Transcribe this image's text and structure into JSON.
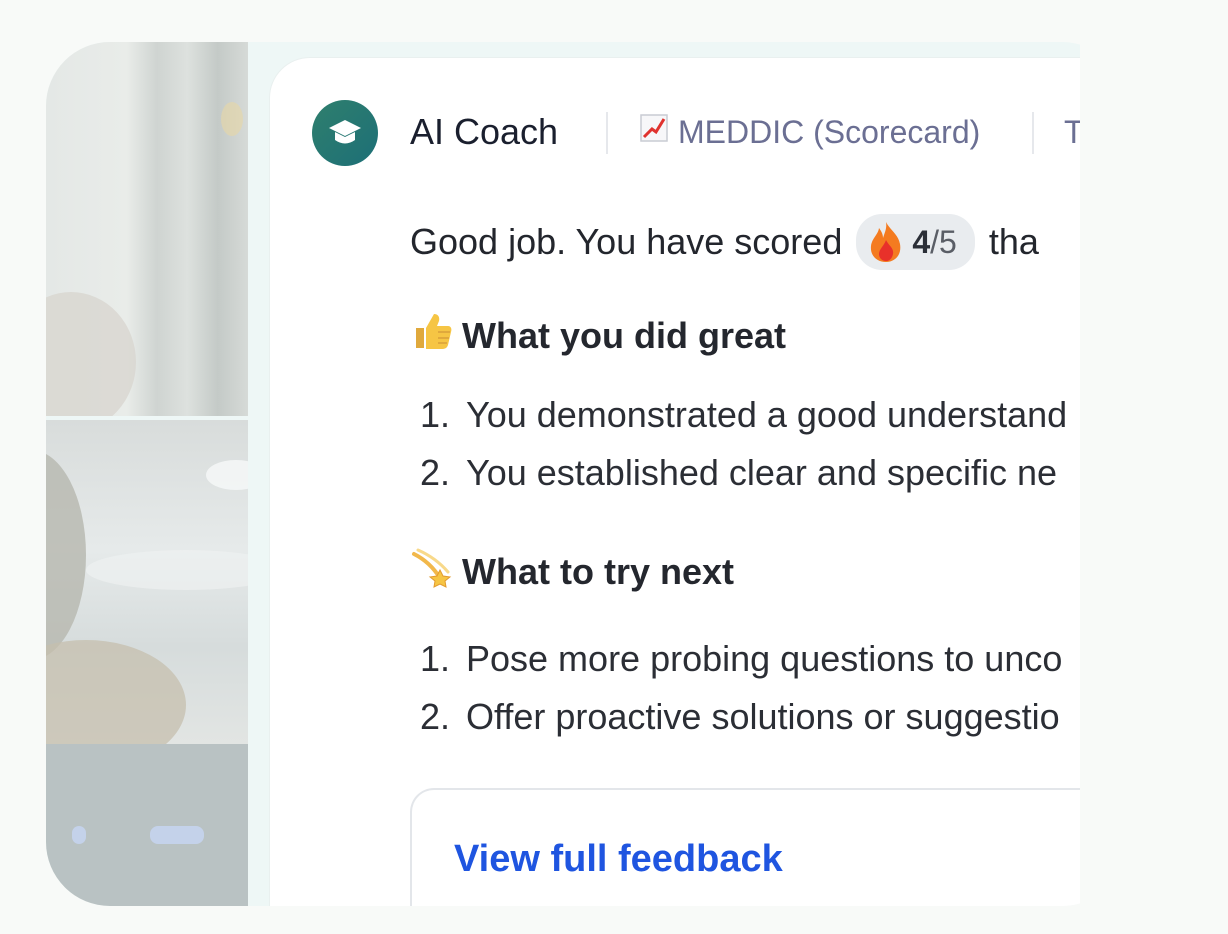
{
  "coach": {
    "name": "AI Coach",
    "scorecard_label": "MEDDIC (Scorecard)",
    "to_label": "To:",
    "avatar_icon": "graduation-cap-icon",
    "avatar_color": "#2a7a70"
  },
  "score": {
    "prefix": "Good job. You have scored",
    "value": "4",
    "total": "/5",
    "suffix": "tha",
    "badge_icon": "fire-icon"
  },
  "sections": {
    "great": {
      "title": "What you did great",
      "icon": "thumbs-up-icon",
      "items": [
        {
          "num": "1.",
          "text": "You demonstrated a good understand"
        },
        {
          "num": "2.",
          "text": "You established clear and specific ne"
        }
      ]
    },
    "next": {
      "title": "What to try next",
      "icon": "dizzy-star-icon",
      "items": [
        {
          "num": "1.",
          "text": "Pose more probing questions to unco"
        },
        {
          "num": "2.",
          "text": "Offer proactive solutions or suggestio"
        }
      ]
    }
  },
  "feedback": {
    "link_label": "View full feedback",
    "link_color": "#1f55e0"
  }
}
